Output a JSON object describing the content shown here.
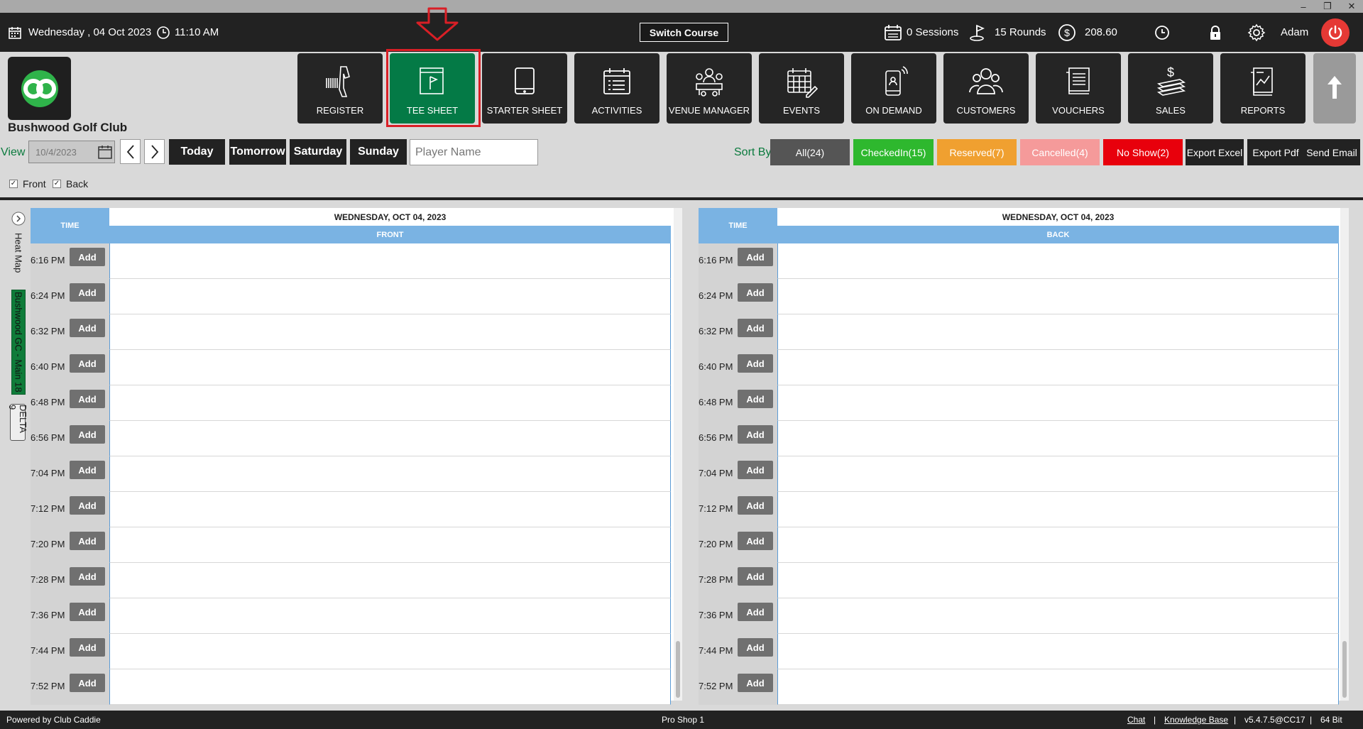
{
  "window": {
    "minimize": "–",
    "restore": "❐",
    "close": "✕"
  },
  "topbar": {
    "date": "Wednesday ,  04 Oct 2023",
    "time": "11:10 AM",
    "switch_course": "Switch Course",
    "sessions": "0 Sessions",
    "rounds": "15 Rounds",
    "balance": "208.60",
    "user": "Adam"
  },
  "club": {
    "name": "Bushwood Golf Club"
  },
  "nav": [
    {
      "label": "REGISTER"
    },
    {
      "label": "TEE SHEET"
    },
    {
      "label": "STARTER SHEET"
    },
    {
      "label": "ACTIVITIES"
    },
    {
      "label": "VENUE MANAGER"
    },
    {
      "label": "EVENTS"
    },
    {
      "label": "ON DEMAND"
    },
    {
      "label": "CUSTOMERS"
    },
    {
      "label": "VOUCHERS"
    },
    {
      "label": "SALES"
    },
    {
      "label": "REPORTS"
    }
  ],
  "toolbar": {
    "view_label": "View",
    "date_value": "10/4/2023",
    "days": [
      "Today",
      "Tomorrow",
      "Saturday",
      "Sunday"
    ],
    "player_placeholder": "Player Name",
    "sort_label": "Sort By",
    "filters": [
      {
        "label": "All(24)",
        "color": "#555555"
      },
      {
        "label": "CheckedIn(15)",
        "color": "#2eb82e"
      },
      {
        "label": "Reserved(7)",
        "color": "#f0a030"
      },
      {
        "label": "Cancelled(4)",
        "color": "#f59a9a"
      },
      {
        "label": "No Show(2)",
        "color": "#e8000c"
      }
    ],
    "exports": [
      "Export Excel",
      "Export Pdf",
      "Send Email"
    ],
    "checkboxes": [
      {
        "label": "Front",
        "checked": true
      },
      {
        "label": "Back",
        "checked": true
      }
    ]
  },
  "side": {
    "heat_map": "Heat Map",
    "course": "Bushwood GC - Main 18",
    "delta": "DELTA 9"
  },
  "sheets": [
    {
      "time_header": "TIME",
      "date_header": "WEDNESDAY, OCT 04, 2023",
      "section": "FRONT"
    },
    {
      "time_header": "TIME",
      "date_header": "WEDNESDAY, OCT 04, 2023",
      "section": "BACK"
    }
  ],
  "times": [
    "6:16 PM",
    "6:24 PM",
    "6:32 PM",
    "6:40 PM",
    "6:48 PM",
    "6:56 PM",
    "7:04 PM",
    "7:12 PM",
    "7:20 PM",
    "7:28 PM",
    "7:36 PM",
    "7:44 PM",
    "7:52 PM"
  ],
  "add_label": "Add",
  "footer": {
    "powered": "Powered by Club Caddie",
    "station": "Pro Shop 1",
    "chat": "Chat",
    "kb": "Knowledge Base",
    "version": "v5.4.7.5@CC17",
    "bits": "64 Bit",
    "sep": "|"
  }
}
